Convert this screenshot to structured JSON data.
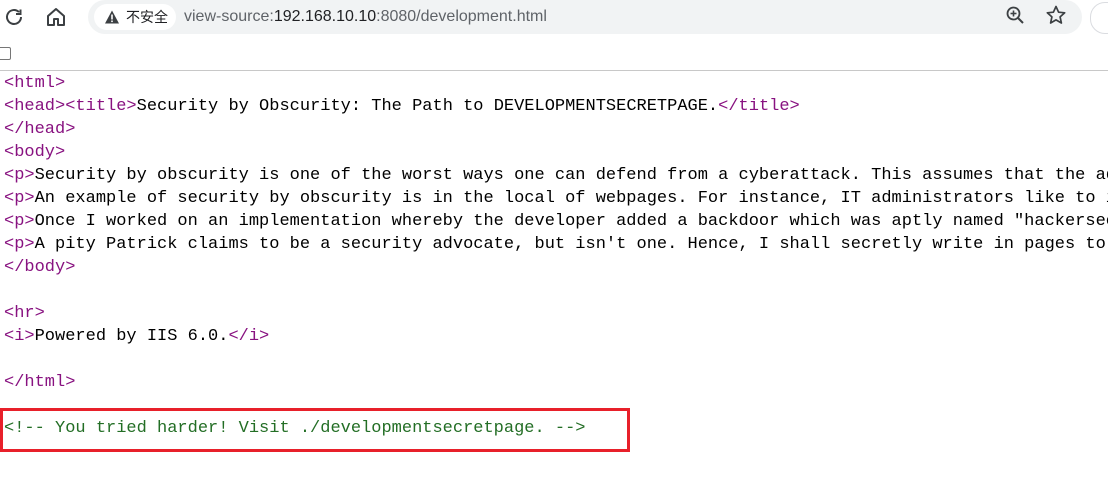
{
  "toolbar": {
    "reload_icon": "reload-icon",
    "home_icon": "home-icon",
    "security_label": "不安全",
    "url": {
      "scheme": "view-source:",
      "host": "192.168.10.10",
      "path": ":8080/development.html"
    },
    "zoom_icon": "zoom-in-icon",
    "bookmark_icon": "star-icon"
  },
  "source_lines": {
    "l1": {
      "open": "<html>"
    },
    "l2": {
      "t1": "<head>",
      "t2": "<title>",
      "text": "Security by Obscurity: The Path to DEVELOPMENTSECRETPAGE.",
      "t3": "</title>"
    },
    "l3": {
      "tag": "</head>"
    },
    "l4": {
      "tag": "<body>"
    },
    "l5": {
      "tag": "<p>",
      "text": "Security by obscurity is one of the worst ways one can defend from a cyberattack. This assumes that the ad"
    },
    "l6": {
      "tag": "<p>",
      "text": "An example of security by obscurity is in the local of webpages. For instance, IT administrators like to i"
    },
    "l7": {
      "tag": "<p>",
      "text": "Once I worked on an implementation whereby the developer added a backdoor which was aptly named \"hackersec"
    },
    "l8": {
      "tag": "<p>",
      "text": "A pity Patrick claims to be a security advocate, but isn't one. Hence, I shall secretly write in pages to"
    },
    "l9": {
      "tag": "</body>"
    },
    "l11": {
      "tag": "<hr>"
    },
    "l12": {
      "t1": "<i>",
      "text": "Powered by IIS 6.0.",
      "t2": "</i>"
    },
    "l14": {
      "tag": "</html>"
    },
    "l16": {
      "comment": "<!-- You tried harder! Visit ./developmentsecretpage. -->"
    }
  },
  "colors": {
    "tag": "#881280",
    "comment": "#236e25",
    "highlight": "#e8202a"
  }
}
